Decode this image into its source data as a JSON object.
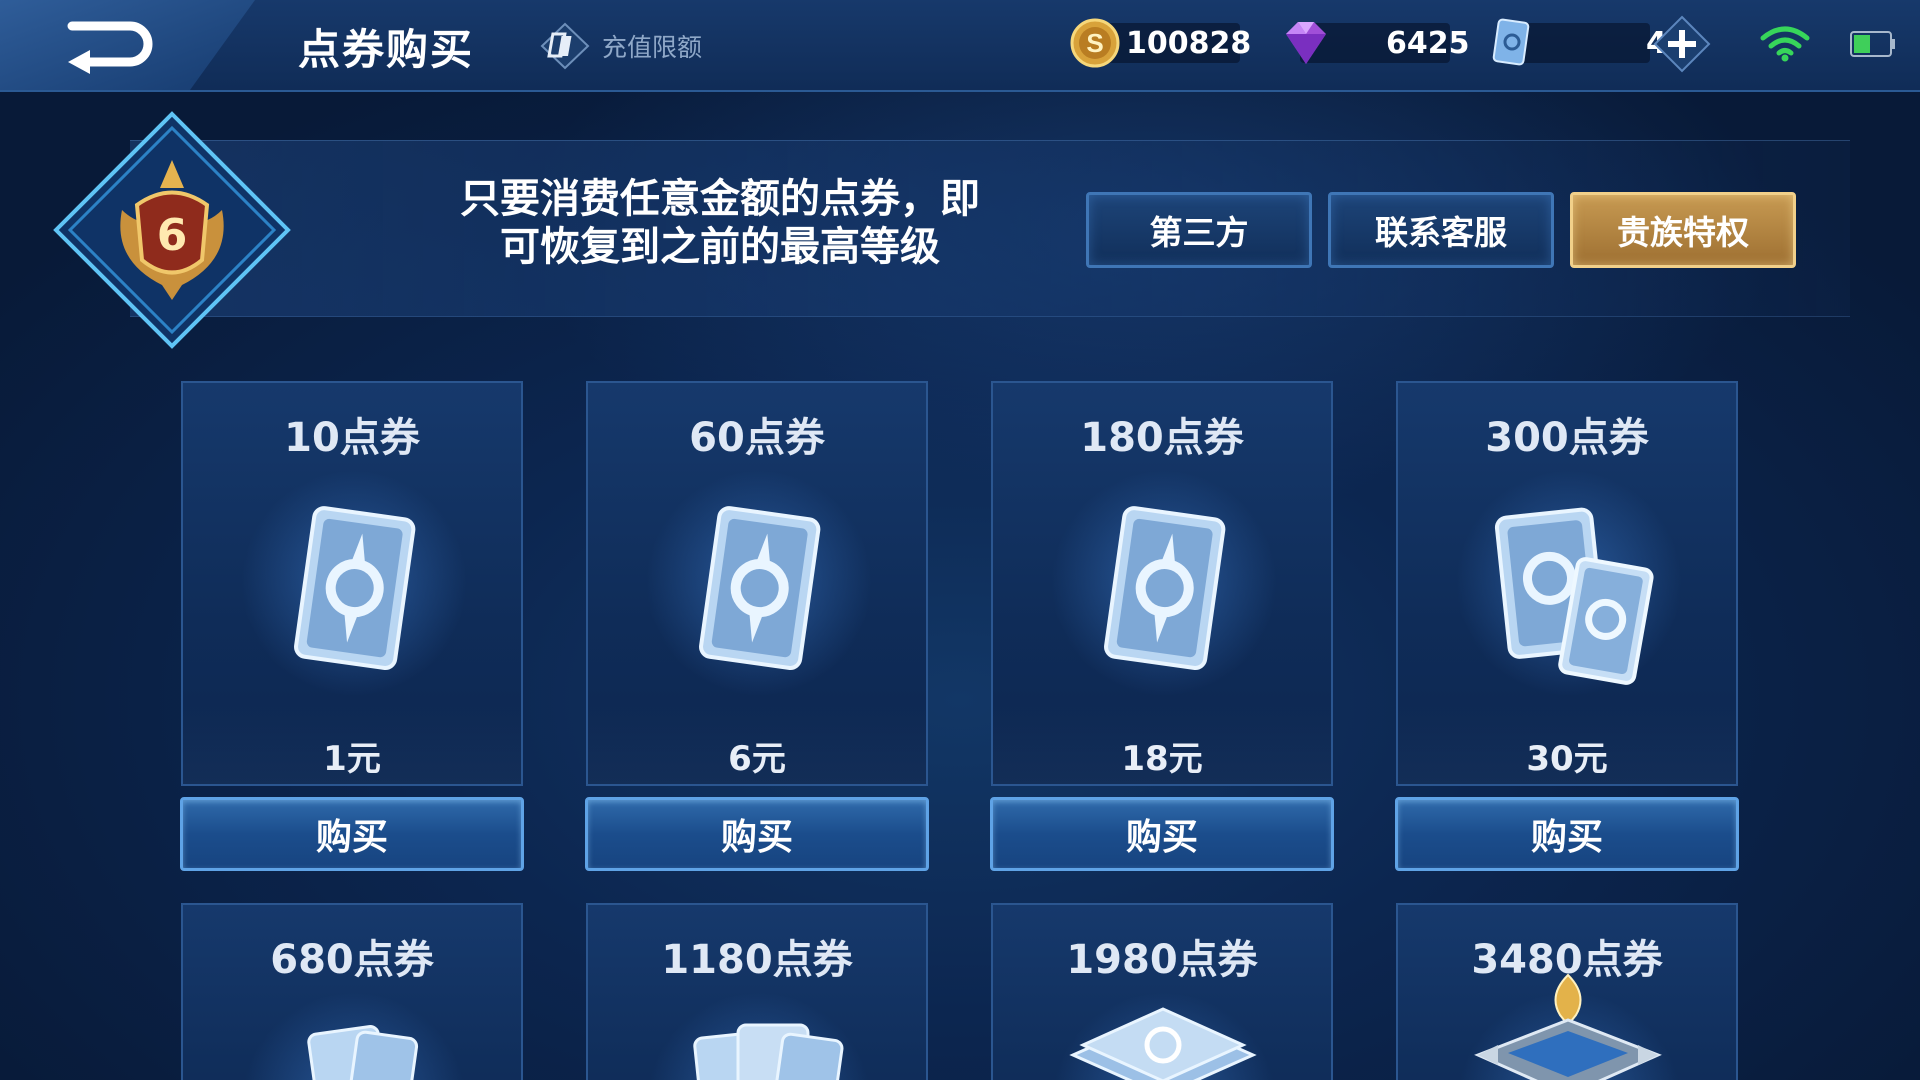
{
  "header": {
    "title": "点券购买",
    "recharge_limit_label": "充值限额",
    "gold_amount": "100828",
    "diamond_amount": "6425",
    "coupon_amount": "4"
  },
  "banner": {
    "rank_level": "6",
    "message_line1": "只要消费任意金额的点券，即",
    "message_line2": "可恢复到之前的最高等级",
    "buttons": {
      "third_party": "第三方",
      "contact_service": "联系客服",
      "noble_privilege": "贵族特权"
    }
  },
  "packages": [
    {
      "title": "10点券",
      "price": "1元",
      "buy_label": "购买"
    },
    {
      "title": "60点券",
      "price": "6元",
      "buy_label": "购买"
    },
    {
      "title": "180点券",
      "price": "18元",
      "buy_label": "购买"
    },
    {
      "title": "300点券",
      "price": "30元",
      "buy_label": "购买"
    },
    {
      "title": "680点券"
    },
    {
      "title": "1180点券"
    },
    {
      "title": "1980点券"
    },
    {
      "title": "3480点券"
    }
  ],
  "colors": {
    "background": "#0c2346",
    "accent_blue": "#3f76b6",
    "gold_button": "#c79a52",
    "wifi": "#37d65a",
    "battery": "#3fcf5a"
  },
  "icons": {
    "back": "back-arrow-icon",
    "recharge_limit": "card-icon",
    "gold": "gold-coin-icon",
    "diamond": "diamond-icon",
    "coupon": "coupon-icon",
    "plus": "plus-icon",
    "wifi": "wifi-icon",
    "battery": "battery-icon",
    "rank": "rank-emblem-icon",
    "voucher": "voucher-card-icon"
  }
}
